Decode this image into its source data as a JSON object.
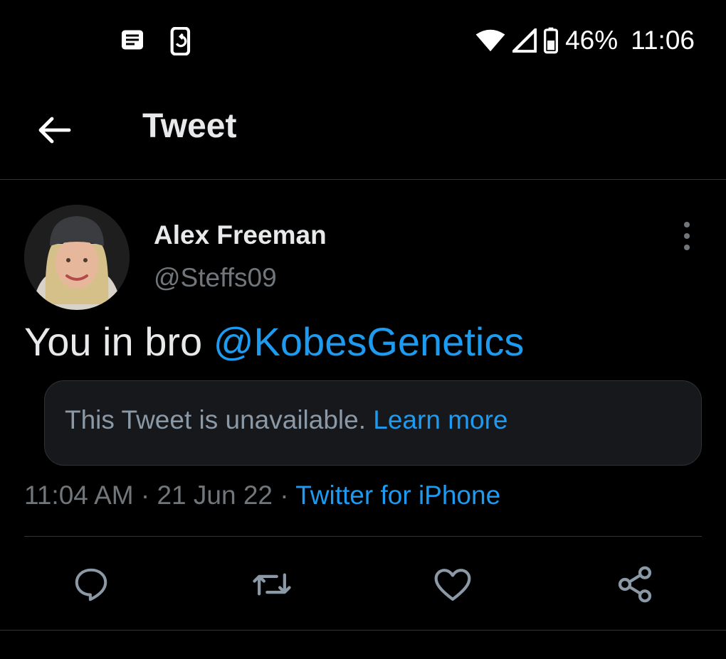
{
  "status_bar": {
    "battery": "46%",
    "time": "11:06",
    "icons": [
      "news-icon",
      "phone-sync-icon",
      "wifi-icon",
      "signal-icon",
      "battery-icon"
    ]
  },
  "header": {
    "title": "Tweet",
    "back_icon": "arrow-left-icon"
  },
  "tweet": {
    "author_name": "Alex Freeman",
    "author_handle": "@Steffs09",
    "text_prefix": "You in bro ",
    "mention": "@KobesGenetics",
    "quote": {
      "message": "This Tweet is unavailable.",
      "link": "Learn more"
    },
    "time": "11:04 AM",
    "date": "21 Jun 22",
    "separator": "·",
    "source": "Twitter for iPhone"
  },
  "actions": [
    "reply-icon",
    "retweet-icon",
    "like-icon",
    "share-icon"
  ],
  "colors": {
    "background": "#000000",
    "text": "#e7e9ea",
    "secondary": "#71767b",
    "accent": "#1d9bf0",
    "divider": "#2f3336"
  }
}
